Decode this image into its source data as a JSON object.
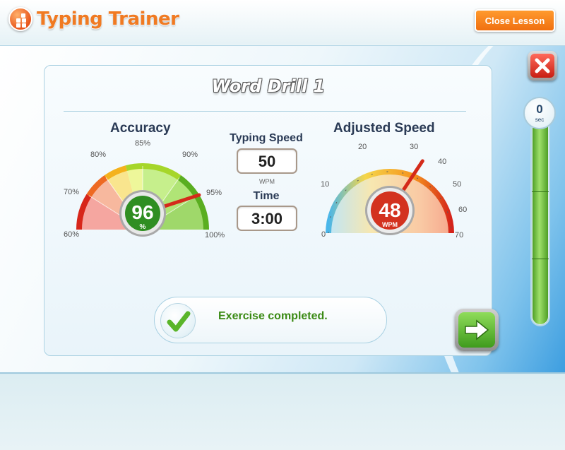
{
  "app": {
    "title": "Typing Trainer",
    "close_lesson_label": "Close Lesson",
    "accent": "#f07a22"
  },
  "drill": {
    "title": "Word Drill 1"
  },
  "accuracy": {
    "title": "Accuracy",
    "value": "96",
    "value_num": 96,
    "unit": "%",
    "ticks": [
      "60%",
      "70%",
      "80%",
      "85%",
      "90%",
      "95%",
      "100%"
    ],
    "range": [
      60,
      100
    ]
  },
  "typing_speed": {
    "label": "Typing Speed",
    "value": "50",
    "unit": "WPM"
  },
  "time": {
    "label": "Time",
    "value": "3:00"
  },
  "adjusted_speed": {
    "title": "Adjusted Speed",
    "value": "48",
    "value_num": 48,
    "unit": "WPM",
    "ticks": [
      "0",
      "10",
      "20",
      "30",
      "40",
      "50",
      "60",
      "70"
    ],
    "range": [
      0,
      70
    ]
  },
  "status": {
    "message": "Exercise completed.",
    "icon": "checkmark-icon"
  },
  "timer": {
    "value": "0",
    "unit": "sec"
  },
  "colors": {
    "success": "#3a8a14",
    "needle": "#d42a1a",
    "danger": "#c81e12"
  }
}
